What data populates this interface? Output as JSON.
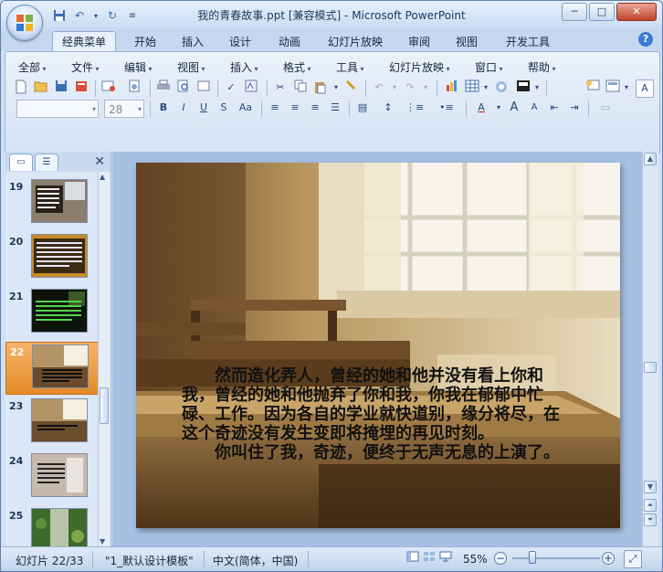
{
  "window": {
    "title": "我的青春故事.ppt [兼容模式] - Microsoft PowerPoint",
    "minimize": "─",
    "maximize": "□",
    "close": "✕"
  },
  "quick_access": {
    "save_icon": "save-icon",
    "undo_icon": "undo-icon",
    "redo_icon": "redo-icon",
    "customize_icon": "customize-icon"
  },
  "tabs": [
    "经典菜单",
    "开始",
    "插入",
    "设计",
    "动画",
    "幻灯片放映",
    "审阅",
    "视图",
    "开发工具"
  ],
  "active_tab": "经典菜单",
  "classic_menus": [
    "全部",
    "文件",
    "编辑",
    "视图",
    "插入",
    "格式",
    "工具",
    "幻灯片放映",
    "窗口",
    "帮助"
  ],
  "font_size": "28",
  "toolbar_misc": {
    "bold": "B",
    "italic": "I",
    "underline": "U",
    "strikethrough": "S",
    "change_case": "Aa",
    "font_color": "A",
    "grow_font": "A",
    "shrink_font": "A"
  },
  "panel": {
    "tab_slides_icon": "slides-tab-icon",
    "tab_outline_icon": "outline-tab-icon",
    "close": "✕"
  },
  "slides": [
    {
      "num": "19"
    },
    {
      "num": "20"
    },
    {
      "num": "21"
    },
    {
      "num": "22"
    },
    {
      "num": "23"
    },
    {
      "num": "24"
    },
    {
      "num": "25"
    }
  ],
  "selected_slide": "22",
  "slide_text": {
    "para1": "然而造化弄人，曾经的她和他并没有看上你和我，曾经的她和他抛弃了你和我，你我在郁郁中忙碌、工作。因为各自的学业就快道别，缘分将尽，在这个奇迹没有发生变即将掩埋的再见时刻。",
    "para2": "你叫住了我，奇迹，便终于无声无息的上演了。"
  },
  "status": {
    "slide_info": "幻灯片 22/33",
    "theme": "\"1_默认设计模板\"",
    "language": "中文(简体，中国)",
    "zoom": "55%",
    "zoom_level": 0.55
  },
  "colors": {
    "selected_thumb": "#e48a28",
    "ribbon_bg": "#dbe7f6",
    "edit_bg": "#a6c0e3"
  }
}
